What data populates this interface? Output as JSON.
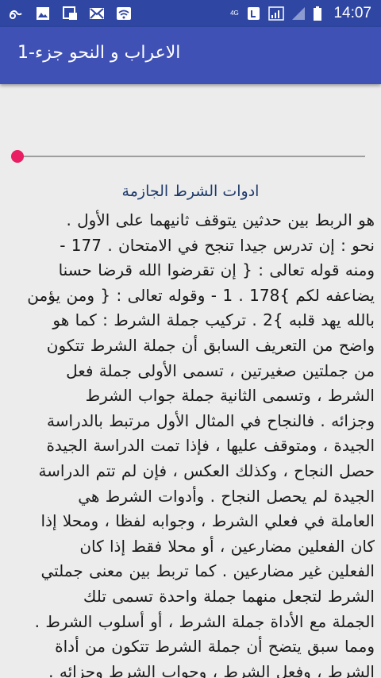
{
  "status_bar": {
    "time": "14:07",
    "network": "4G",
    "left_icons": [
      "notification-icon",
      "image-icon",
      "screenshot-icon",
      "mail-icon",
      "wifi-icon"
    ],
    "right_icons": [
      "data-icon",
      "nfc-icon",
      "signal-icon",
      "signal-empty-icon",
      "battery-icon"
    ]
  },
  "app_bar": {
    "title": "الاعراب و النحو جزء-1"
  },
  "player": {
    "progress": 0,
    "thumb_color": "#e91e63"
  },
  "document": {
    "title": "ادوات الشرط الجازمة",
    "lines": [
      "هو الربط بين حدثين يتوقف ثانيهما على الأول .",
      "نحو : إن تدرس جيدا تنجح في الامتحان . 177 -",
      "ومنه قوله تعالى : { إن تقرضوا الله قرضا حسنا",
      "يضاعفه لكم }178 . 1 - وقوله تعالى : { ومن يؤمن",
      "بالله يهد قلبه }2 . تركيب جملة الشرط : كما هو",
      "واضح من التعريف السابق أن جملة الشرط تتكون",
      "من جملتين صغيرتين ، تسمى الأولى جملة فعل",
      "الشرط ، وتسمى الثانية جملة جواب الشرط",
      "وجزائه . فالنجاح في المثال الأول مرتبط بالدراسة",
      "الجيدة ، ومتوقف عليها ، فإذا تمت الدراسة الجيدة",
      "حصل النجاح ، وكذلك العكس ، فإن لم تتم الدراسة",
      "الجيدة لم يحصل النجاح . وأدوات الشرط هي",
      "العاملة في فعلي الشرط ، وجوابه لفظا ، ومحلا إذا",
      "كان الفعلين مضارعين ، أو محلا فقط إذا كان",
      "الفعلين غير مضارعين . كما تربط بين معنى جملتي",
      "الشرط لتجعل منهما جملة واحدة تسمى تلك",
      "الجملة مع الأداة جملة الشرط ، أو أسلوب الشرط .",
      "ومما سبق يتضح أن جملة الشرط تتكون من أداة",
      "الشرط ، وفعل الشرط ، وجواب الشرط وجزائه ."
    ]
  }
}
